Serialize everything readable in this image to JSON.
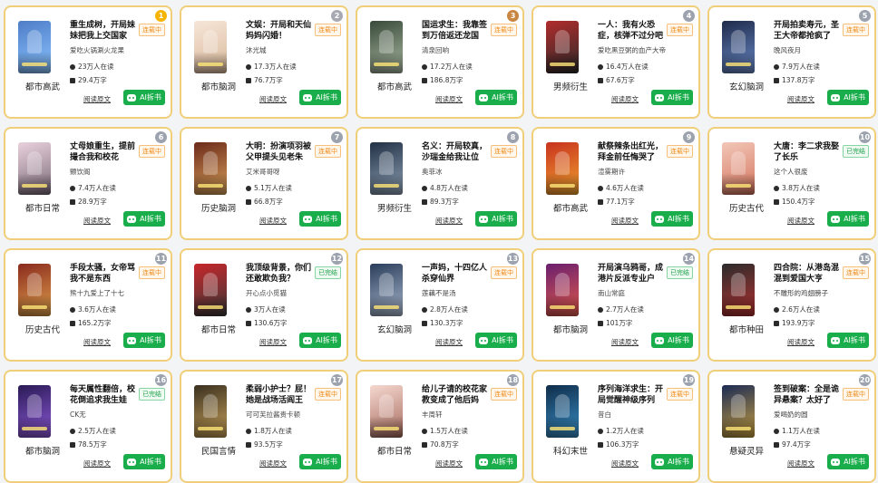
{
  "labels": {
    "read": "阅读原文",
    "ai": "AI拆书"
  },
  "status_colors": {
    "连载中": "#f08c1b",
    "已完结": "#1ea14a"
  },
  "rank_colors": {
    "1": "#f5b400",
    "2": "#a7aab2",
    "3": "#c98640",
    "other": "#9ca3af"
  },
  "books": [
    {
      "rank": "1",
      "title": "重生成树，开局妹妹把我上交国家",
      "status": "连载中",
      "author": "爱吃火锅涮火龙果",
      "readers": "23万人在读",
      "words": "29.4万字",
      "genre": "都市高武",
      "cover_colors": [
        "#4f7dc7",
        "#89c3ff"
      ]
    },
    {
      "rank": "2",
      "title": "文娱：开局和天仙妈妈闪婚！",
      "status": "连载中",
      "author": "沐光城",
      "readers": "17.3万人在读",
      "words": "76.7万字",
      "genre": "都市脑洞",
      "cover_colors": [
        "#f6e6d8",
        "#d9b89a"
      ]
    },
    {
      "rank": "3",
      "title": "国运求生：我靠签到万倍返还龙国",
      "status": "连载中",
      "author": "清泉回响",
      "readers": "17.2万人在读",
      "words": "186.8万字",
      "genre": "都市高武",
      "cover_colors": [
        "#3a4a3a",
        "#a9b9a2"
      ]
    },
    {
      "rank": "4",
      "title": "一人：我有火恐症，核弹不过分吧",
      "status": "连载中",
      "author": "爱吃黑豆粥的血产大帝",
      "readers": "16.4万人在读",
      "words": "67.6万字",
      "genre": "男频衍生",
      "cover_colors": [
        "#b12c2c",
        "#2a2a2a"
      ]
    },
    {
      "rank": "5",
      "title": "开局拍卖寿元，圣王大帝都抢疯了",
      "status": "连载中",
      "author": "晚风夜月",
      "readers": "7.9万人在读",
      "words": "137.8万字",
      "genre": "玄幻脑洞",
      "cover_colors": [
        "#1e2a4a",
        "#6a8ac7"
      ]
    },
    {
      "rank": "6",
      "title": "丈母娘重生，提前撮合我和校花",
      "status": "连载中",
      "author": "颤饮阁",
      "readers": "7.4万人在读",
      "words": "28.9万字",
      "genre": "都市日常",
      "cover_colors": [
        "#e9d2dc",
        "#7c6b7a"
      ]
    },
    {
      "rank": "7",
      "title": "大明：扮演项羽被父甲提头见老朱",
      "status": "连载中",
      "author": "艾米哥哥呀",
      "readers": "5.1万人在读",
      "words": "66.8万字",
      "genre": "历史脑洞",
      "cover_colors": [
        "#6b2a1a",
        "#d9a05a"
      ]
    },
    {
      "rank": "8",
      "title": "名义：开局较真，沙瑞金给我让位",
      "status": "连载中",
      "author": "奥菲冰",
      "readers": "4.8万人在读",
      "words": "89.3万字",
      "genre": "男频衍生",
      "cover_colors": [
        "#223044",
        "#8fa3b8"
      ]
    },
    {
      "rank": "9",
      "title": "献祭辣条出红光，拜金前任悔哭了",
      "status": "连载中",
      "author": "渲雾期许",
      "readers": "4.6万人在读",
      "words": "77.1万字",
      "genre": "都市高武",
      "cover_colors": [
        "#c8321f",
        "#f0a32f"
      ]
    },
    {
      "rank": "10",
      "title": "大唐：李二求我娶了长乐",
      "status": "已完结",
      "author": "这个人很废",
      "readers": "3.8万人在读",
      "words": "150.4万字",
      "genre": "历史古代",
      "cover_colors": [
        "#f2c7b8",
        "#d4745c"
      ]
    },
    {
      "rank": "11",
      "title": "手段太骚，女帝骂我不是东西",
      "status": "连载中",
      "author": "熊十九爱上了十七",
      "readers": "3.6万人在读",
      "words": "165.2万字",
      "genre": "历史古代",
      "cover_colors": [
        "#8a2b1f",
        "#e0a04a"
      ]
    },
    {
      "rank": "12",
      "title": "我顶级背景，你们还敢欺负我？",
      "status": "已完结",
      "author": "开心点小觅猫",
      "readers": "3万人在读",
      "words": "130.6万字",
      "genre": "都市日常",
      "cover_colors": [
        "#c7262a",
        "#3a3a3a"
      ]
    },
    {
      "rank": "13",
      "title": "一声妈，十四亿人杀穿仙界",
      "status": "连载中",
      "author": "莲藕不是汤",
      "readers": "2.8万人在读",
      "words": "130.3万字",
      "genre": "玄幻脑洞",
      "cover_colors": [
        "#2a3d5a",
        "#aab9d0"
      ]
    },
    {
      "rank": "14",
      "title": "开局演乌鸦哥，成港片反派专业户",
      "status": "已完结",
      "author": "南山常庭",
      "readers": "2.7万人在读",
      "words": "101万字",
      "genre": "都市脑洞",
      "cover_colors": [
        "#6a1f6e",
        "#e35a4c"
      ]
    },
    {
      "rank": "15",
      "title": "四合院：从港岛混混到爱国大亨",
      "status": "连载中",
      "author": "不雕形的鸡翅膀子",
      "readers": "2.6万人在读",
      "words": "193.9万字",
      "genre": "都市种田",
      "cover_colors": [
        "#2c2c2c",
        "#b23030"
      ]
    },
    {
      "rank": "16",
      "title": "每天属性翻倍，校花倒追求我生娃",
      "status": "已完结",
      "author": "CK无",
      "readers": "2.5万人在读",
      "words": "78.5万字",
      "genre": "都市脑洞",
      "cover_colors": [
        "#2a1a55",
        "#8e5ad9"
      ]
    },
    {
      "rank": "17",
      "title": "柔弱小护士？屁！她是战场活阎王",
      "status": "连载中",
      "author": "可可芙拉酱贵卡顿",
      "readers": "1.8万人在读",
      "words": "93.5万字",
      "genre": "民国言情",
      "cover_colors": [
        "#3a3020",
        "#c9a25a"
      ]
    },
    {
      "rank": "18",
      "title": "给儿子请的校花家教变成了他后妈",
      "status": "连载中",
      "author": "丰周轩",
      "readers": "1.5万人在读",
      "words": "70.8万字",
      "genre": "都市日常",
      "cover_colors": [
        "#f5d8d0",
        "#a66a5c"
      ]
    },
    {
      "rank": "19",
      "title": "序列海洋求生：开局觉醒神级序列",
      "status": "连载中",
      "author": "昔白",
      "readers": "1.2万人在读",
      "words": "106.3万字",
      "genre": "科幻末世",
      "cover_colors": [
        "#0f2d4a",
        "#3a8fc7"
      ]
    },
    {
      "rank": "20",
      "title": "签到破案：全是诡异悬案？太好了",
      "status": "连载中",
      "author": "爱喝奶的圆",
      "readers": "1.1万人在读",
      "words": "97.4万字",
      "genre": "悬疑灵异",
      "cover_colors": [
        "#1c2b55",
        "#c8a040"
      ]
    }
  ]
}
